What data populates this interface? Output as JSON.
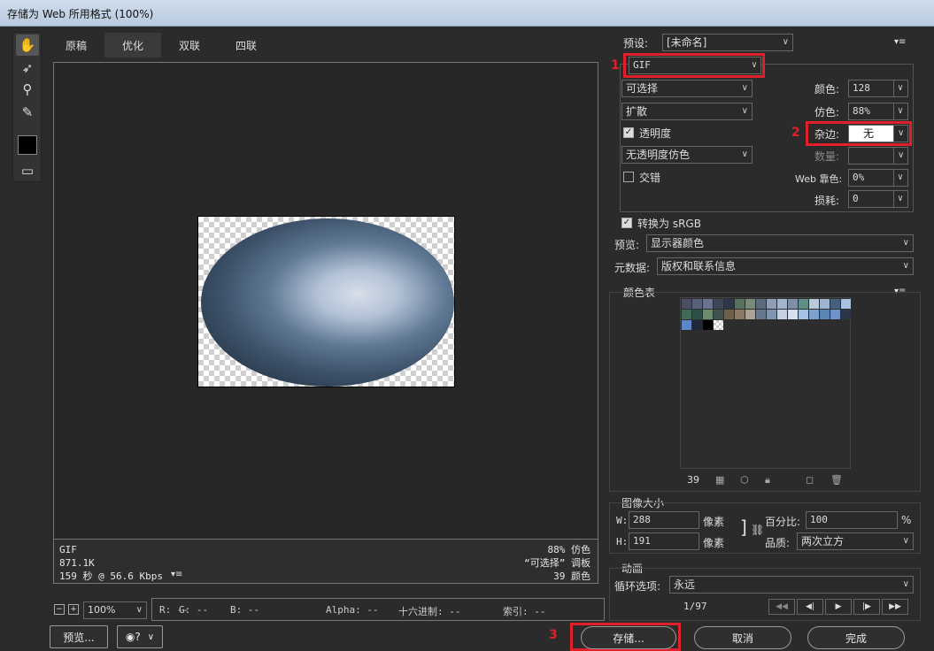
{
  "window": {
    "title": "存储为 Web 所用格式 (100%)"
  },
  "tabs": [
    {
      "label": "原稿"
    },
    {
      "label": "优化"
    },
    {
      "label": "双联"
    },
    {
      "label": "四联"
    }
  ],
  "info": {
    "format": "GIF",
    "size": "871.1K",
    "time": "159 秒 @ 56.6 Kbps",
    "dither": "88% 仿色",
    "palette": "“可选择” 调板",
    "colors": "39 颜色"
  },
  "zoom": {
    "value": "100%"
  },
  "readout": {
    "r": "R: --",
    "g": "G: --",
    "b": "B: --",
    "alpha": "Alpha: --",
    "hex": "十六进制: --",
    "index": "索引: --"
  },
  "buttons": {
    "preview": "预览...",
    "save": "存储...",
    "cancel": "取消",
    "done": "完成"
  },
  "panel": {
    "preset_label": "预设:",
    "preset_value": "[未命名]",
    "format": "GIF",
    "reduction": "可选择",
    "dither_algo": "扩散",
    "transparency_label": "透明度",
    "trans_dither": "无透明度仿色",
    "interlaced_label": "交错",
    "colors_label": "颜色:",
    "colors_value": "128",
    "dither_label": "仿色:",
    "dither_value": "88%",
    "matte_label": "杂边:",
    "matte_value": "无",
    "amount_label": "数量:",
    "websnap_label": "Web 靠色:",
    "websnap_value": "0%",
    "lossy_label": "损耗:",
    "lossy_value": "0",
    "srgb_label": "转换为 sRGB",
    "preview_label": "预览:",
    "preview_value": "显示器颜色",
    "metadata_label": "元数据:",
    "metadata_value": "版权和联系信息",
    "color_table_title": "颜色表",
    "color_count": "39",
    "image_size_title": "图像大小",
    "w_label": "W:",
    "w_value": "288",
    "h_label": "H:",
    "h_value": "191",
    "px": "像素",
    "percent_label": "百分比:",
    "percent_value": "100",
    "percent_unit": "%",
    "quality_label": "品质:",
    "quality_value": "两次立方",
    "animation_title": "动画",
    "loop_label": "循环选项:",
    "loop_value": "永远",
    "frame": "1/97"
  },
  "annotations": [
    "1",
    "2",
    "3"
  ],
  "palette_colors": [
    "#4a4f63",
    "#58617a",
    "#6a7390",
    "#3e4658",
    "#2f3648",
    "#58705f",
    "#7b8a78",
    "#5c6a7c",
    "#8d9eb5",
    "#a3b4cc",
    "#7f8fa8",
    "#5f8e86",
    "#bcc9db",
    "#9fb4d0",
    "#44627a",
    "#a9c0e0",
    "#3f6a58",
    "#2f4e48",
    "#6f8c6e",
    "#40524f",
    "#6e5f4d",
    "#8a7a66",
    "#a9a39a",
    "#67788c",
    "#7f95b0",
    "#c5d2e3",
    "#d6e0ee",
    "#a4c1e6",
    "#7fa2cc",
    "#5b86b4",
    "#6f93c9",
    "#2c3646",
    "#5d86c8",
    "#202838",
    "#000000"
  ]
}
